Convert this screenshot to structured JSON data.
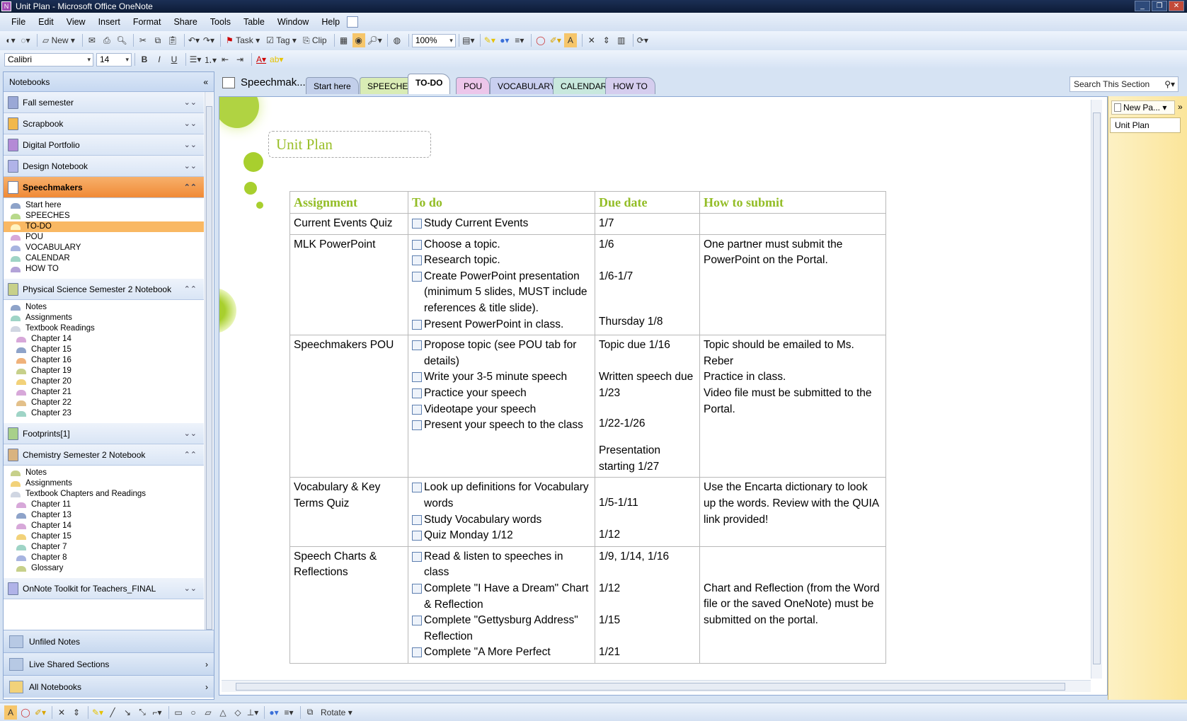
{
  "window": {
    "title": "Unit Plan - Microsoft Office OneNote"
  },
  "menu": [
    "File",
    "Edit",
    "View",
    "Insert",
    "Format",
    "Share",
    "Tools",
    "Table",
    "Window",
    "Help"
  ],
  "toolbar": {
    "new_label": "New",
    "task_label": "Task",
    "tag_label": "Tag",
    "clip_label": "Clip",
    "zoom": "100%",
    "font": "Calibri",
    "size": "14",
    "bold": "B",
    "italic": "I",
    "underline": "U",
    "font_color_glyph": "A"
  },
  "nav": {
    "header": "Notebooks",
    "notebooks_top": [
      {
        "label": "Fall semester",
        "color": "#9aa8d6"
      },
      {
        "label": "Scrapbook",
        "color": "#f2b84b"
      },
      {
        "label": "Digital Portfolio",
        "color": "#b48ad6"
      },
      {
        "label": "Design Notebook",
        "color": "#b0b3e8"
      }
    ],
    "speech": {
      "label": "Speechmakers",
      "sections": [
        "Start here",
        "SPEECHES",
        "TO-DO",
        "POU",
        "VOCABULARY",
        "CALENDAR",
        "HOW TO"
      ]
    },
    "phys": {
      "label": "Physical Science Semester 2 Notebook",
      "sections": [
        "Notes",
        "Assignments"
      ],
      "group": "Textbook Readings",
      "group_items": [
        "Chapter 14",
        "Chapter 15",
        "Chapter 16",
        "Chapter 19",
        "Chapter 20",
        "Chapter 21",
        "Chapter 22",
        "Chapter 23"
      ]
    },
    "footprints": "Footprints[1]",
    "chem": {
      "label": "Chemistry Semester 2 Notebook",
      "sections": [
        "Notes",
        "Assignments"
      ],
      "group": "Textbook Chapters and Readings",
      "group_items": [
        "Chapter 11",
        "Chapter 13",
        "Chapter 14",
        "Chapter 15",
        "Chapter 7",
        "Chapter 8",
        "Glossary"
      ]
    },
    "toolkit": "OnNote Toolkit for Teachers_FINAL",
    "bottom": [
      "Unfiled Notes",
      "Live Shared Sections",
      "All Notebooks"
    ]
  },
  "section_title": "Speechmak...",
  "tabs": [
    "Start here",
    "SPEECHES",
    "TO-DO",
    "POU",
    "VOCABULARY",
    "CALENDAR",
    "HOW TO"
  ],
  "search_placeholder": "Search This Section",
  "page": {
    "title": "Unit Plan",
    "headers": [
      "Assignment",
      "To do",
      "Due date",
      "How to submit"
    ],
    "r1": {
      "a": "Current Events Quiz",
      "t": [
        "Study Current Events"
      ],
      "d": "1/7",
      "h": ""
    },
    "r2": {
      "a": "MLK PowerPoint",
      "t": [
        "Choose a topic.",
        "Research topic.",
        "Create PowerPoint presentation (minimum 5 slides, MUST include references & title slide).",
        "Present PowerPoint in class."
      ],
      "d": [
        "1/6",
        "1/6-1/7",
        "Thursday 1/8"
      ],
      "h": "One partner must submit the PowerPoint on the Portal."
    },
    "r3": {
      "a": "Speechmakers POU",
      "t": [
        "Propose topic (see POU tab for details)",
        "Write your 3-5 minute speech",
        "Practice your speech",
        "Videotape your speech",
        "Present your speech to the class"
      ],
      "d": [
        "Topic due 1/16",
        "Written speech due 1/23",
        "1/22-1/26",
        "Presentation starting 1/27"
      ],
      "h": [
        "Topic should be emailed to Ms. Reber",
        "Practice in class.",
        "Video file must be submitted to the Portal."
      ]
    },
    "r4": {
      "a": "Vocabulary & Key Terms Quiz",
      "t": [
        "Look up definitions for Vocabulary words",
        "Study Vocabulary words",
        "Quiz Monday 1/12"
      ],
      "d": [
        "1/5-1/11",
        "1/12"
      ],
      "h": "Use the Encarta dictionary to look up the words. Review with the QUIA link provided!"
    },
    "r5": {
      "a": "Speech Charts & Reflections",
      "t": [
        "Read & listen to speeches in class",
        "Complete \"I Have a Dream\" Chart & Reflection",
        "Complete \"Gettysburg Address\" Reflection",
        "Complete \"A More Perfect"
      ],
      "d": [
        "1/9, 1/14, 1/16",
        "1/12",
        "1/15",
        "1/21"
      ],
      "h": "Chart and Reflection (from the Word file or the saved OneNote) must be submitted on the portal."
    }
  },
  "pages": {
    "new_label": "New Pa...",
    "items": [
      "Unit Plan"
    ]
  },
  "drawing": {
    "rotate_label": "Rotate"
  }
}
